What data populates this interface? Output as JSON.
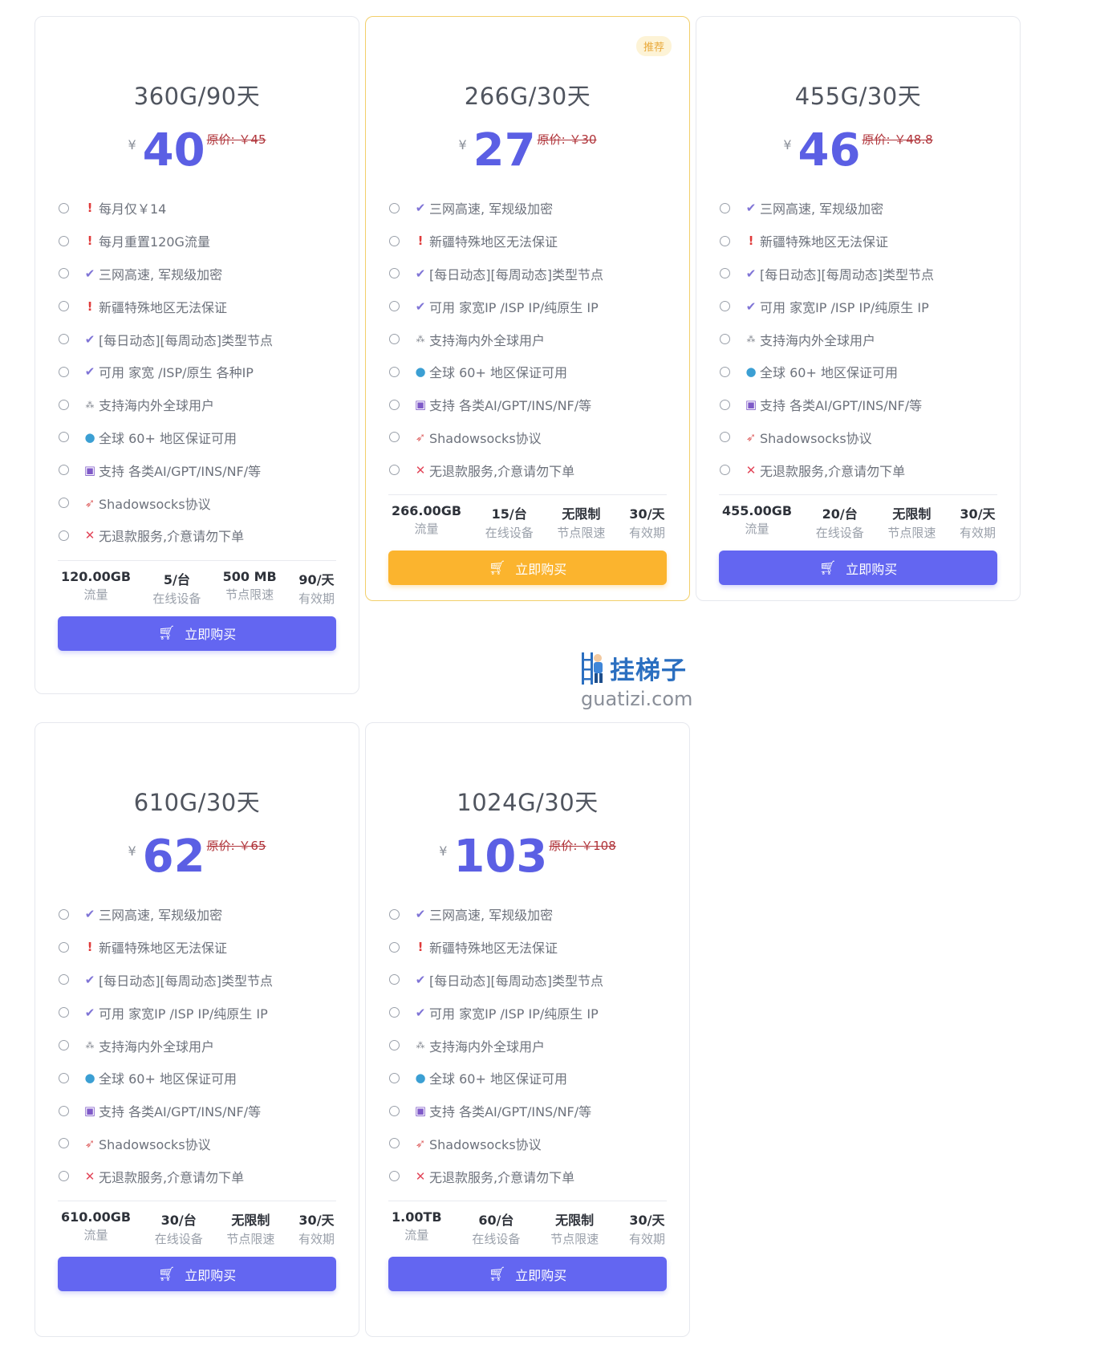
{
  "common": {
    "buy_label": "立即购买",
    "original_prefix": "原价: ",
    "currency": "¥"
  },
  "plans": [
    {
      "title": "360G/90天",
      "price": "40",
      "original": "原价: ￥45",
      "currency": "¥",
      "features": [
        {
          "icon": "warn",
          "text": "每月仅￥14"
        },
        {
          "icon": "warn",
          "text": "每月重置120G流量"
        },
        {
          "icon": "check",
          "text": "三网高速, 军规级加密"
        },
        {
          "icon": "warn",
          "text": "新疆特殊地区无法保证"
        },
        {
          "icon": "check",
          "text": "[每日动态][每周动态]类型节点"
        },
        {
          "icon": "check",
          "text": "可用 家宽 /ISP/原生 各种IP"
        },
        {
          "icon": "dots",
          "text": "支持海内外全球用户"
        },
        {
          "icon": "globe",
          "text": "全球 60+ 地区保证可用"
        },
        {
          "icon": "robot",
          "text": "支持 各类AI/GPT/INS/NF/等"
        },
        {
          "icon": "rocket",
          "text": "Shadowsocks协议"
        },
        {
          "icon": "cross",
          "text": "无退款服务,介意请勿下单"
        }
      ],
      "stats": [
        {
          "value": "120.00GB",
          "label": "流量"
        },
        {
          "value": "5/台",
          "label": "在线设备"
        },
        {
          "value": "500 MB",
          "label": "节点限速"
        },
        {
          "value": "90/天",
          "label": "有效期"
        }
      ]
    },
    {
      "title": "266G/30天",
      "price": "27",
      "original": "原价: ￥30",
      "currency": "¥",
      "badge": "推荐",
      "features": [
        {
          "icon": "check",
          "text": "三网高速, 军规级加密"
        },
        {
          "icon": "warn",
          "text": "新疆特殊地区无法保证"
        },
        {
          "icon": "check",
          "text": "[每日动态][每周动态]类型节点"
        },
        {
          "icon": "check",
          "text": "可用 家宽IP /ISP IP/纯原生 IP"
        },
        {
          "icon": "dots",
          "text": "支持海内外全球用户"
        },
        {
          "icon": "globe",
          "text": "全球 60+ 地区保证可用"
        },
        {
          "icon": "robot",
          "text": "支持 各类AI/GPT/INS/NF/等"
        },
        {
          "icon": "rocket",
          "text": "Shadowsocks协议"
        },
        {
          "icon": "cross",
          "text": "无退款服务,介意请勿下单"
        }
      ],
      "stats": [
        {
          "value": "266.00GB",
          "label": "流量"
        },
        {
          "value": "15/台",
          "label": "在线设备"
        },
        {
          "value": "无限制",
          "label": "节点限速"
        },
        {
          "value": "30/天",
          "label": "有效期"
        }
      ]
    },
    {
      "title": "455G/30天",
      "price": "46",
      "original": "原价: ￥48.8",
      "currency": "¥",
      "features": [
        {
          "icon": "check",
          "text": "三网高速, 军规级加密"
        },
        {
          "icon": "warn",
          "text": "新疆特殊地区无法保证"
        },
        {
          "icon": "check",
          "text": "[每日动态][每周动态]类型节点"
        },
        {
          "icon": "check",
          "text": "可用 家宽IP /ISP IP/纯原生 IP"
        },
        {
          "icon": "dots",
          "text": "支持海内外全球用户"
        },
        {
          "icon": "globe",
          "text": "全球 60+ 地区保证可用"
        },
        {
          "icon": "robot",
          "text": "支持 各类AI/GPT/INS/NF/等"
        },
        {
          "icon": "rocket",
          "text": "Shadowsocks协议"
        },
        {
          "icon": "cross",
          "text": "无退款服务,介意请勿下单"
        }
      ],
      "stats": [
        {
          "value": "455.00GB",
          "label": "流量"
        },
        {
          "value": "20/台",
          "label": "在线设备"
        },
        {
          "value": "无限制",
          "label": "节点限速"
        },
        {
          "value": "30/天",
          "label": "有效期"
        }
      ]
    },
    {
      "title": "610G/30天",
      "price": "62",
      "original": "原价: ￥65",
      "currency": "¥",
      "features": [
        {
          "icon": "check",
          "text": "三网高速, 军规级加密"
        },
        {
          "icon": "warn",
          "text": "新疆特殊地区无法保证"
        },
        {
          "icon": "check",
          "text": "[每日动态][每周动态]类型节点"
        },
        {
          "icon": "check",
          "text": "可用 家宽IP /ISP IP/纯原生 IP"
        },
        {
          "icon": "dots",
          "text": "支持海内外全球用户"
        },
        {
          "icon": "globe",
          "text": "全球 60+ 地区保证可用"
        },
        {
          "icon": "robot",
          "text": "支持 各类AI/GPT/INS/NF/等"
        },
        {
          "icon": "rocket",
          "text": "Shadowsocks协议"
        },
        {
          "icon": "cross",
          "text": "无退款服务,介意请勿下单"
        }
      ],
      "stats": [
        {
          "value": "610.00GB",
          "label": "流量"
        },
        {
          "value": "30/台",
          "label": "在线设备"
        },
        {
          "value": "无限制",
          "label": "节点限速"
        },
        {
          "value": "30/天",
          "label": "有效期"
        }
      ]
    },
    {
      "title": "1024G/30天",
      "price": "103",
      "original": "原价: ￥108",
      "currency": "¥",
      "features": [
        {
          "icon": "check",
          "text": "三网高速, 军规级加密"
        },
        {
          "icon": "warn",
          "text": "新疆特殊地区无法保证"
        },
        {
          "icon": "check",
          "text": "[每日动态][每周动态]类型节点"
        },
        {
          "icon": "check",
          "text": "可用 家宽IP /ISP IP/纯原生 IP"
        },
        {
          "icon": "dots",
          "text": "支持海内外全球用户"
        },
        {
          "icon": "globe",
          "text": "全球 60+ 地区保证可用"
        },
        {
          "icon": "robot",
          "text": "支持 各类AI/GPT/INS/NF/等"
        },
        {
          "icon": "rocket",
          "text": "Shadowsocks协议"
        },
        {
          "icon": "cross",
          "text": "无退款服务,介意请勿下单"
        }
      ],
      "stats": [
        {
          "value": "1.00TB",
          "label": "流量"
        },
        {
          "value": "60/台",
          "label": "在线设备"
        },
        {
          "value": "无限制",
          "label": "节点限速"
        },
        {
          "value": "30/天",
          "label": "有效期"
        }
      ]
    }
  ],
  "watermark": {
    "brand": "挂梯子",
    "url": "guatizi.com"
  },
  "colors": {
    "accent": "#6366f1",
    "recommended_button": "#fbb42e",
    "price": "#5b5fe4",
    "original_price": "#b0343a"
  }
}
